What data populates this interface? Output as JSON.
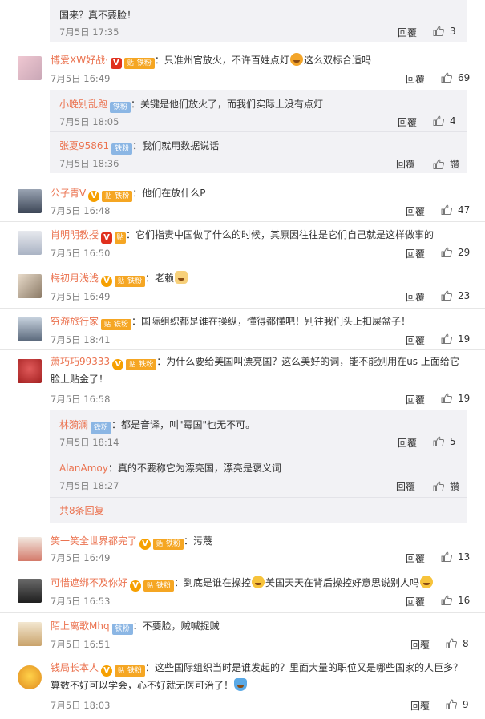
{
  "top": {
    "text": "国来？真不要脸！",
    "time": "7月5日 17:35",
    "reply_label": "回覆",
    "likes": "3"
  },
  "comments": [
    {
      "user": "博爱XW好战·",
      "text": "：只准州官放火，不许百姓点灯",
      "text2": "这么双标合适吗",
      "time": "7月5日 16:49",
      "reply_label": "回覆",
      "likes": "69",
      "fan_label": "铁粉"
    },
    {
      "user": "公子青V",
      "text": "：他们在放什么P",
      "time": "7月5日 16:48",
      "reply_label": "回覆",
      "likes": "47",
      "fan_label": "铁粉"
    },
    {
      "user": "肖明明教授",
      "text": "：它们指责中国做了什么的时候，其原因往往是它们自己就是这样做事的",
      "time": "7月5日 16:50",
      "reply_label": "回覆",
      "likes": "29"
    },
    {
      "user": "梅初月浅浅",
      "text": "：老赖",
      "time": "7月5日 16:49",
      "reply_label": "回覆",
      "likes": "23",
      "fan_label": "铁粉"
    },
    {
      "user": "穷游旅行家",
      "text": "：国际组织都是谁在操纵，懂得都懂吧！别往我们头上扣屎盆子！",
      "time": "7月5日 18:41",
      "reply_label": "回覆",
      "likes": "19",
      "fan_label": "铁粉"
    },
    {
      "user": "萧巧巧99333",
      "text": "：为什么要给美国叫漂亮国？这么美好的词，能不能别用在us 上面给它脸上贴金了！",
      "time": "7月5日 16:58",
      "reply_label": "回覆",
      "likes": "19",
      "fan_label": "铁粉"
    },
    {
      "user": "笑一笑全世界都完了",
      "text": "：污蔑",
      "time": "7月5日 16:49",
      "reply_label": "回覆",
      "likes": "13",
      "fan_label": "铁粉"
    },
    {
      "user": "可惜遮绑不及你好",
      "text": "：到底是谁在操控",
      "text2": "美国天天在背后操控好意思说别人吗",
      "time": "7月5日 16:53",
      "reply_label": "回覆",
      "likes": "16",
      "fan_label": "铁粉"
    },
    {
      "user": "陌上离歌Mhq",
      "text": "：不要脸，贼喊捉贼",
      "time": "7月5日 16:51",
      "reply_label": "回覆",
      "likes": "8",
      "fan_label": "铁粉"
    },
    {
      "user": "钱局长本人",
      "text": "：这些国际组织当时是谁发起的？里面大量的职位又是哪些国家的人巨多？算数不好可以学会，心不好就无医可治了！",
      "time": "7月5日 18:03",
      "reply_label": "回覆",
      "likes": "9",
      "fan_label": "铁粉"
    }
  ],
  "replies_a": [
    {
      "user": "小晚别乱跑",
      "fan_label": "铁粉",
      "text": "：关键是他们放火了，而我们实际上没有点灯",
      "time": "7月5日 18:05",
      "reply_label": "回覆",
      "likes": "4"
    },
    {
      "user": "张夏95861",
      "fan_label": "铁粉",
      "text": "：我们就用数据说话",
      "time": "7月5日 18:36",
      "reply_label": "回覆",
      "likes": "讚"
    }
  ],
  "replies_b": [
    {
      "user": "林漪澜",
      "fan_label": "铁粉",
      "text": "：都是音译，叫\"霉国\"也无不可。",
      "time": "7月5日 18:14",
      "reply_label": "回覆",
      "likes": "5"
    },
    {
      "user": "AlanAmoy",
      "text": "：真的不要称它为漂亮国，漂亮是褒义词",
      "time": "7月5日 18:27",
      "reply_label": "回覆",
      "likes": "讚"
    }
  ],
  "more_replies": "共8条回复"
}
